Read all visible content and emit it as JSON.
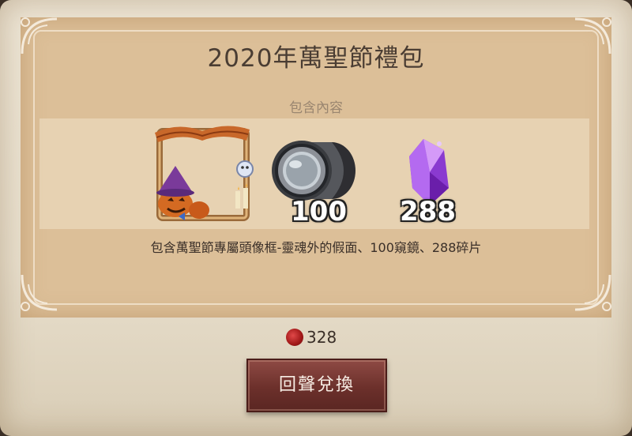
{
  "dialog": {
    "title": "2020年萬聖節禮包",
    "section_label": "包含內容",
    "description": "包含萬聖節專屬頭像框-靈魂外的假面、100窺鏡、288碎片"
  },
  "items": [
    {
      "name": "avatar-frame",
      "quantity": ""
    },
    {
      "name": "peephole-lens",
      "quantity": "100"
    },
    {
      "name": "purple-shard",
      "quantity": "288"
    }
  ],
  "price": {
    "currency_icon": "red-seal-icon",
    "amount": "328"
  },
  "button": {
    "label": "回聲兌換"
  },
  "colors": {
    "button_bg": "#6c302b",
    "panel_bg": "#dcbf98",
    "seal": "#c02020"
  }
}
